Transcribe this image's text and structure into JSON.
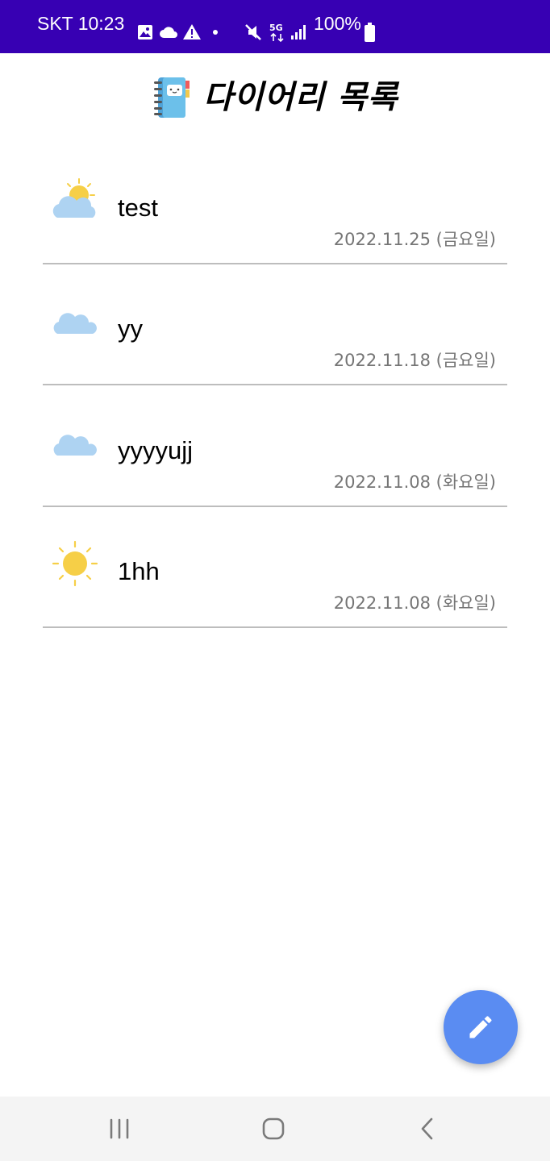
{
  "status_bar": {
    "carrier_time": "SKT 10:23",
    "battery_percent": "100%",
    "background": "#3700b3",
    "icons": [
      "image-icon",
      "cloud-icon",
      "warning-icon",
      "dot-icon",
      "mute-icon",
      "5g-icon",
      "signal-icon",
      "battery-icon"
    ]
  },
  "header": {
    "title": "다이어리 목록",
    "logo_icon": "notebook-icon"
  },
  "diaries": [
    {
      "title": "test",
      "date": "2022.11.25 (금요일)",
      "weather": "partly-cloudy-icon"
    },
    {
      "title": "yy",
      "date": "2022.11.18 (금요일)",
      "weather": "cloud-icon"
    },
    {
      "title": "yyyyujj",
      "date": "2022.11.08 (화요일)",
      "weather": "cloud-icon"
    },
    {
      "title": "1hh",
      "date": "2022.11.08 (화요일)",
      "weather": "sun-icon"
    }
  ],
  "fab": {
    "icon": "edit-pencil-icon",
    "color": "#5a8cf2"
  },
  "nav_bar": {
    "icons": [
      "recent-apps-icon",
      "home-icon",
      "back-icon"
    ]
  }
}
